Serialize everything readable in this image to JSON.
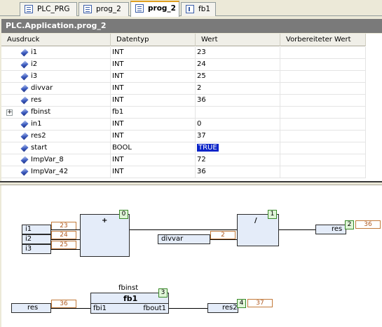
{
  "tabs": [
    {
      "label": "PLC_PRG",
      "icon": "program-icon"
    },
    {
      "label": "prog_2",
      "icon": "program-icon"
    },
    {
      "label": "prog_2",
      "icon": "program-icon",
      "active": true
    },
    {
      "label": "fb1",
      "icon": "function-block-icon"
    }
  ],
  "title": "PLC.Application.prog_2",
  "grid": {
    "headers": [
      "Ausdruck",
      "Datentyp",
      "Wert",
      "Vorbereiteter Wert"
    ],
    "rows": [
      {
        "name": "i1",
        "type": "INT",
        "value": "23",
        "prepared": ""
      },
      {
        "name": "i2",
        "type": "INT",
        "value": "24",
        "prepared": ""
      },
      {
        "name": "i3",
        "type": "INT",
        "value": "25",
        "prepared": ""
      },
      {
        "name": "divvar",
        "type": "INT",
        "value": "2",
        "prepared": ""
      },
      {
        "name": "res",
        "type": "INT",
        "value": "36",
        "prepared": ""
      },
      {
        "name": "fbinst",
        "type": "fb1",
        "value": "",
        "prepared": "",
        "expandable": true,
        "expander": "+"
      },
      {
        "name": "in1",
        "type": "INT",
        "value": "0",
        "prepared": ""
      },
      {
        "name": "res2",
        "type": "INT",
        "value": "37",
        "prepared": ""
      },
      {
        "name": "start",
        "type": "BOOL",
        "value": "TRUE",
        "prepared": "",
        "highlight": true
      },
      {
        "name": "ImpVar_8",
        "type": "INT",
        "value": "72",
        "prepared": ""
      },
      {
        "name": "ImpVar_42",
        "type": "INT",
        "value": "36",
        "prepared": ""
      }
    ]
  },
  "cfc": {
    "add_block": {
      "op": "+",
      "order": "0"
    },
    "div_block": {
      "op": "/",
      "order": "1"
    },
    "inputs": [
      {
        "label": "i1",
        "value": "23"
      },
      {
        "label": "i2",
        "value": "24"
      },
      {
        "label": "i3",
        "value": "25"
      }
    ],
    "divvar": {
      "label": "divvar",
      "value": "2"
    },
    "res_out": {
      "label": "res",
      "order": "2",
      "value": "36"
    },
    "fb": {
      "instance": "fbinst",
      "type": "fb1",
      "order": "3",
      "in_pin": "fbi1",
      "out_pin": "fbout1"
    },
    "res_in": {
      "label": "res",
      "value": "36"
    },
    "res2_out": {
      "label": "res2",
      "order": "4",
      "value": "37"
    }
  }
}
